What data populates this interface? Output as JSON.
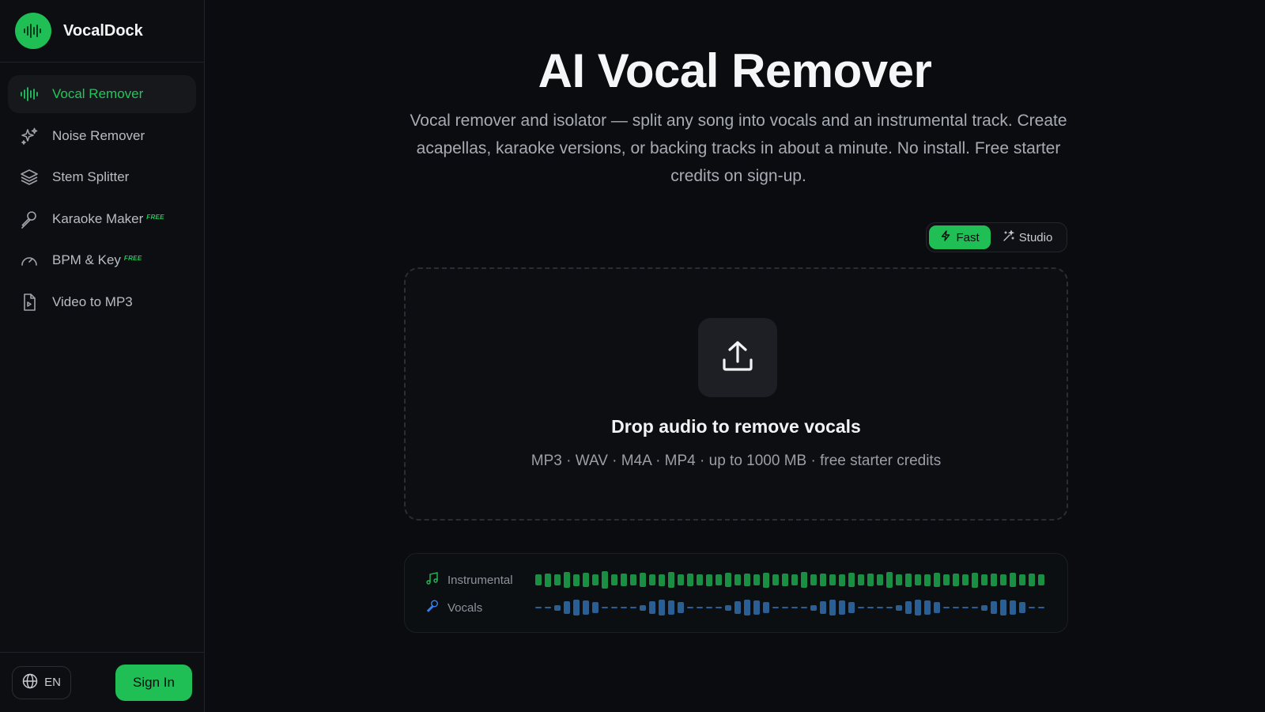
{
  "brand": {
    "name": "VocalDock"
  },
  "nav": {
    "items": [
      {
        "label": "Vocal Remover",
        "icon": "waveform-icon",
        "active": true,
        "badge": ""
      },
      {
        "label": "Noise Remover",
        "icon": "sparkles-icon",
        "active": false,
        "badge": ""
      },
      {
        "label": "Stem Splitter",
        "icon": "layers-icon",
        "active": false,
        "badge": ""
      },
      {
        "label": "Karaoke Maker",
        "icon": "microphone-icon",
        "active": false,
        "badge": "FREE"
      },
      {
        "label": "BPM & Key",
        "icon": "gauge-icon",
        "active": false,
        "badge": "FREE"
      },
      {
        "label": "Video to MP3",
        "icon": "file-music-icon",
        "active": false,
        "badge": ""
      }
    ]
  },
  "footer": {
    "language": "EN",
    "signin_label": "Sign In"
  },
  "main": {
    "title": "AI Vocal Remover",
    "subtitle": "Vocal remover and isolator — split any song into vocals and an instrumental track. Create acapellas, karaoke versions, or backing tracks in about a minute. No install. Free starter credits on sign-up."
  },
  "mode": {
    "fast_label": "Fast",
    "studio_label": "Studio",
    "selected": "Fast"
  },
  "dropzone": {
    "title": "Drop audio to remove vocals",
    "subtitle": "MP3 · WAV · M4A · MP4 · up to 1000 MB · free starter credits"
  },
  "preview": {
    "instrumental_label": "Instrumental",
    "vocals_label": "Vocals"
  },
  "colors": {
    "accent": "#1fbf55",
    "accent_text": "#22c55e",
    "instrumental_wave": "#1a8f44",
    "vocals_wave": "#2b5f94",
    "background": "#0b0c0f"
  }
}
